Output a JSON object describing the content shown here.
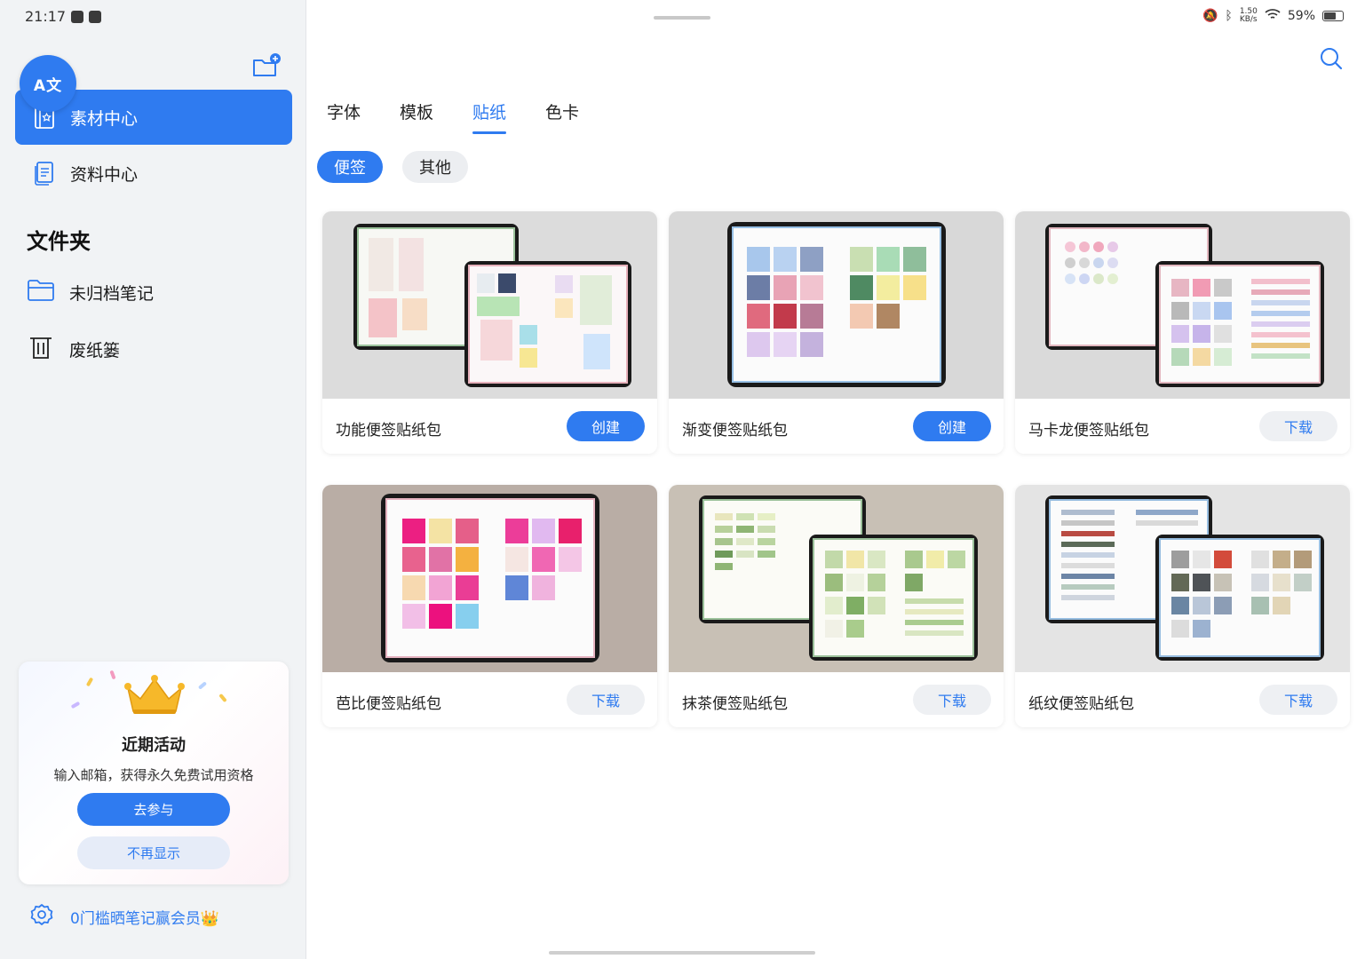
{
  "status": {
    "time": "21:17",
    "net_speed_value": "1.50",
    "net_speed_unit": "KB/s",
    "battery": "59%"
  },
  "sidebar": {
    "translate_badge": "A文",
    "nav": [
      {
        "label": "素材中心",
        "icon": "materials-icon",
        "active": true
      },
      {
        "label": "资料中心",
        "icon": "document-icon",
        "active": false
      }
    ],
    "section_title": "文件夹",
    "folders": [
      {
        "label": "未归档笔记",
        "icon": "folder-icon"
      },
      {
        "label": "废纸篓",
        "icon": "trash-icon"
      }
    ],
    "promo": {
      "title": "近期活动",
      "description": "输入邮箱，获得永久免费试用资格",
      "join_label": "去参与",
      "dismiss_label": "不再显示"
    },
    "footer_link": "0门槛晒笔记赢会员👑"
  },
  "main": {
    "tabs": [
      {
        "label": "字体",
        "active": false
      },
      {
        "label": "模板",
        "active": false
      },
      {
        "label": "贴纸",
        "active": true
      },
      {
        "label": "色卡",
        "active": false
      }
    ],
    "chips": [
      {
        "label": "便签",
        "active": true
      },
      {
        "label": "其他",
        "active": false
      }
    ],
    "cards": [
      {
        "title": "功能便签贴纸包",
        "action": "创建",
        "type": "create"
      },
      {
        "title": "渐变便签贴纸包",
        "action": "创建",
        "type": "create"
      },
      {
        "title": "马卡龙便签贴纸包",
        "action": "下载",
        "type": "download"
      },
      {
        "title": "芭比便签贴纸包",
        "action": "下载",
        "type": "download"
      },
      {
        "title": "抹茶便签贴纸包",
        "action": "下载",
        "type": "download"
      },
      {
        "title": "纸纹便签贴纸包",
        "action": "下载",
        "type": "download"
      }
    ]
  },
  "colors": {
    "accent": "#2f7bf0",
    "sidebar_bg": "#f1f3f5"
  }
}
